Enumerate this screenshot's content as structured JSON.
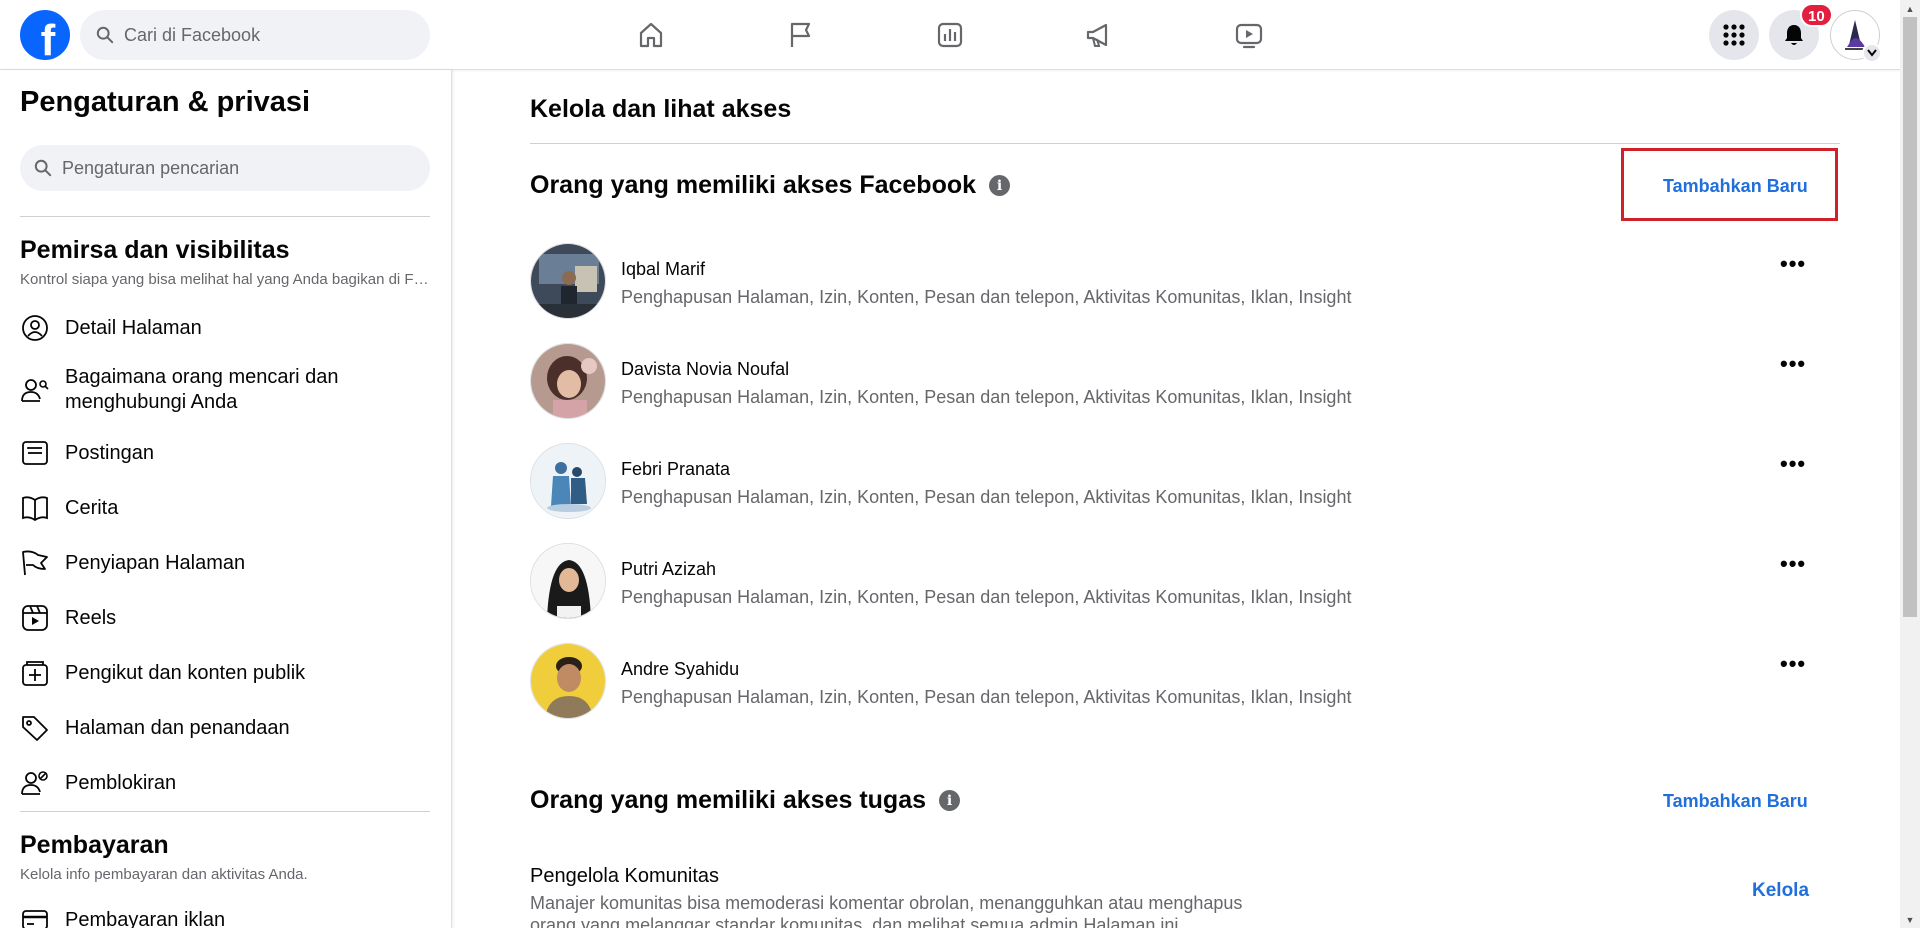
{
  "header": {
    "logo_letter": "f",
    "search_placeholder": "Cari di Facebook",
    "nav_icons": [
      "home-icon",
      "flag-icon",
      "insights-icon",
      "megaphone-icon",
      "video-icon"
    ],
    "notification_count": "10",
    "brand_color": "#0866ff"
  },
  "sidebar": {
    "title": "Pengaturan & privasi",
    "search_placeholder": "Pengaturan pencarian",
    "sections": [
      {
        "title": "Pemirsa dan visibilitas",
        "subtitle": "Kontrol siapa yang bisa melihat hal yang Anda bagikan di Facebook.",
        "items": [
          {
            "label": "Detail Halaman",
            "icon": "profile-circle-icon"
          },
          {
            "label": "Bagaimana orang mencari dan menghubungi Anda",
            "icon": "person-search-icon"
          },
          {
            "label": "Postingan",
            "icon": "post-icon"
          },
          {
            "label": "Cerita",
            "icon": "book-icon"
          },
          {
            "label": "Penyiapan Halaman",
            "icon": "flag-icon"
          },
          {
            "label": "Reels",
            "icon": "reels-icon"
          },
          {
            "label": "Pengikut dan konten publik",
            "icon": "follower-icon"
          },
          {
            "label": "Halaman dan penandaan",
            "icon": "tag-icon"
          },
          {
            "label": "Pemblokiran",
            "icon": "block-user-icon"
          }
        ]
      },
      {
        "title": "Pembayaran",
        "subtitle": "Kelola info pembayaran dan aktivitas Anda.",
        "items": [
          {
            "label": "Pembayaran iklan",
            "icon": "credit-card-icon"
          }
        ]
      }
    ]
  },
  "main": {
    "title": "Kelola dan lihat akses",
    "facebook_access": {
      "title": "Orang yang memiliki akses Facebook",
      "add_label": "Tambahkan Baru",
      "people": [
        {
          "name": "Iqbal Marif",
          "permissions": "Penghapusan Halaman, Izin, Konten, Pesan dan telepon, Aktivitas Komunitas, Iklan, Insight"
        },
        {
          "name": "Davista Novia Noufal",
          "permissions": "Penghapusan Halaman, Izin, Konten, Pesan dan telepon, Aktivitas Komunitas, Iklan, Insight"
        },
        {
          "name": "Febri Pranata",
          "permissions": "Penghapusan Halaman, Izin, Konten, Pesan dan telepon, Aktivitas Komunitas, Iklan, Insight"
        },
        {
          "name": "Putri Azizah",
          "permissions": "Penghapusan Halaman, Izin, Konten, Pesan dan telepon, Aktivitas Komunitas, Iklan, Insight"
        },
        {
          "name": "Andre Syahidu",
          "permissions": "Penghapusan Halaman, Izin, Konten, Pesan dan telepon, Aktivitas Komunitas, Iklan, Insight"
        }
      ],
      "more_label": "•••"
    },
    "task_access": {
      "title": "Orang yang memiliki akses tugas",
      "add_label": "Tambahkan Baru",
      "roles": [
        {
          "name": "Pengelola Komunitas",
          "description": "Manajer komunitas bisa memoderasi komentar obrolan, menangguhkan atau menghapus orang yang melanggar standar komunitas, dan melihat semua admin Halaman ini.",
          "action": "Kelola"
        }
      ]
    },
    "info_glyph": "i"
  }
}
